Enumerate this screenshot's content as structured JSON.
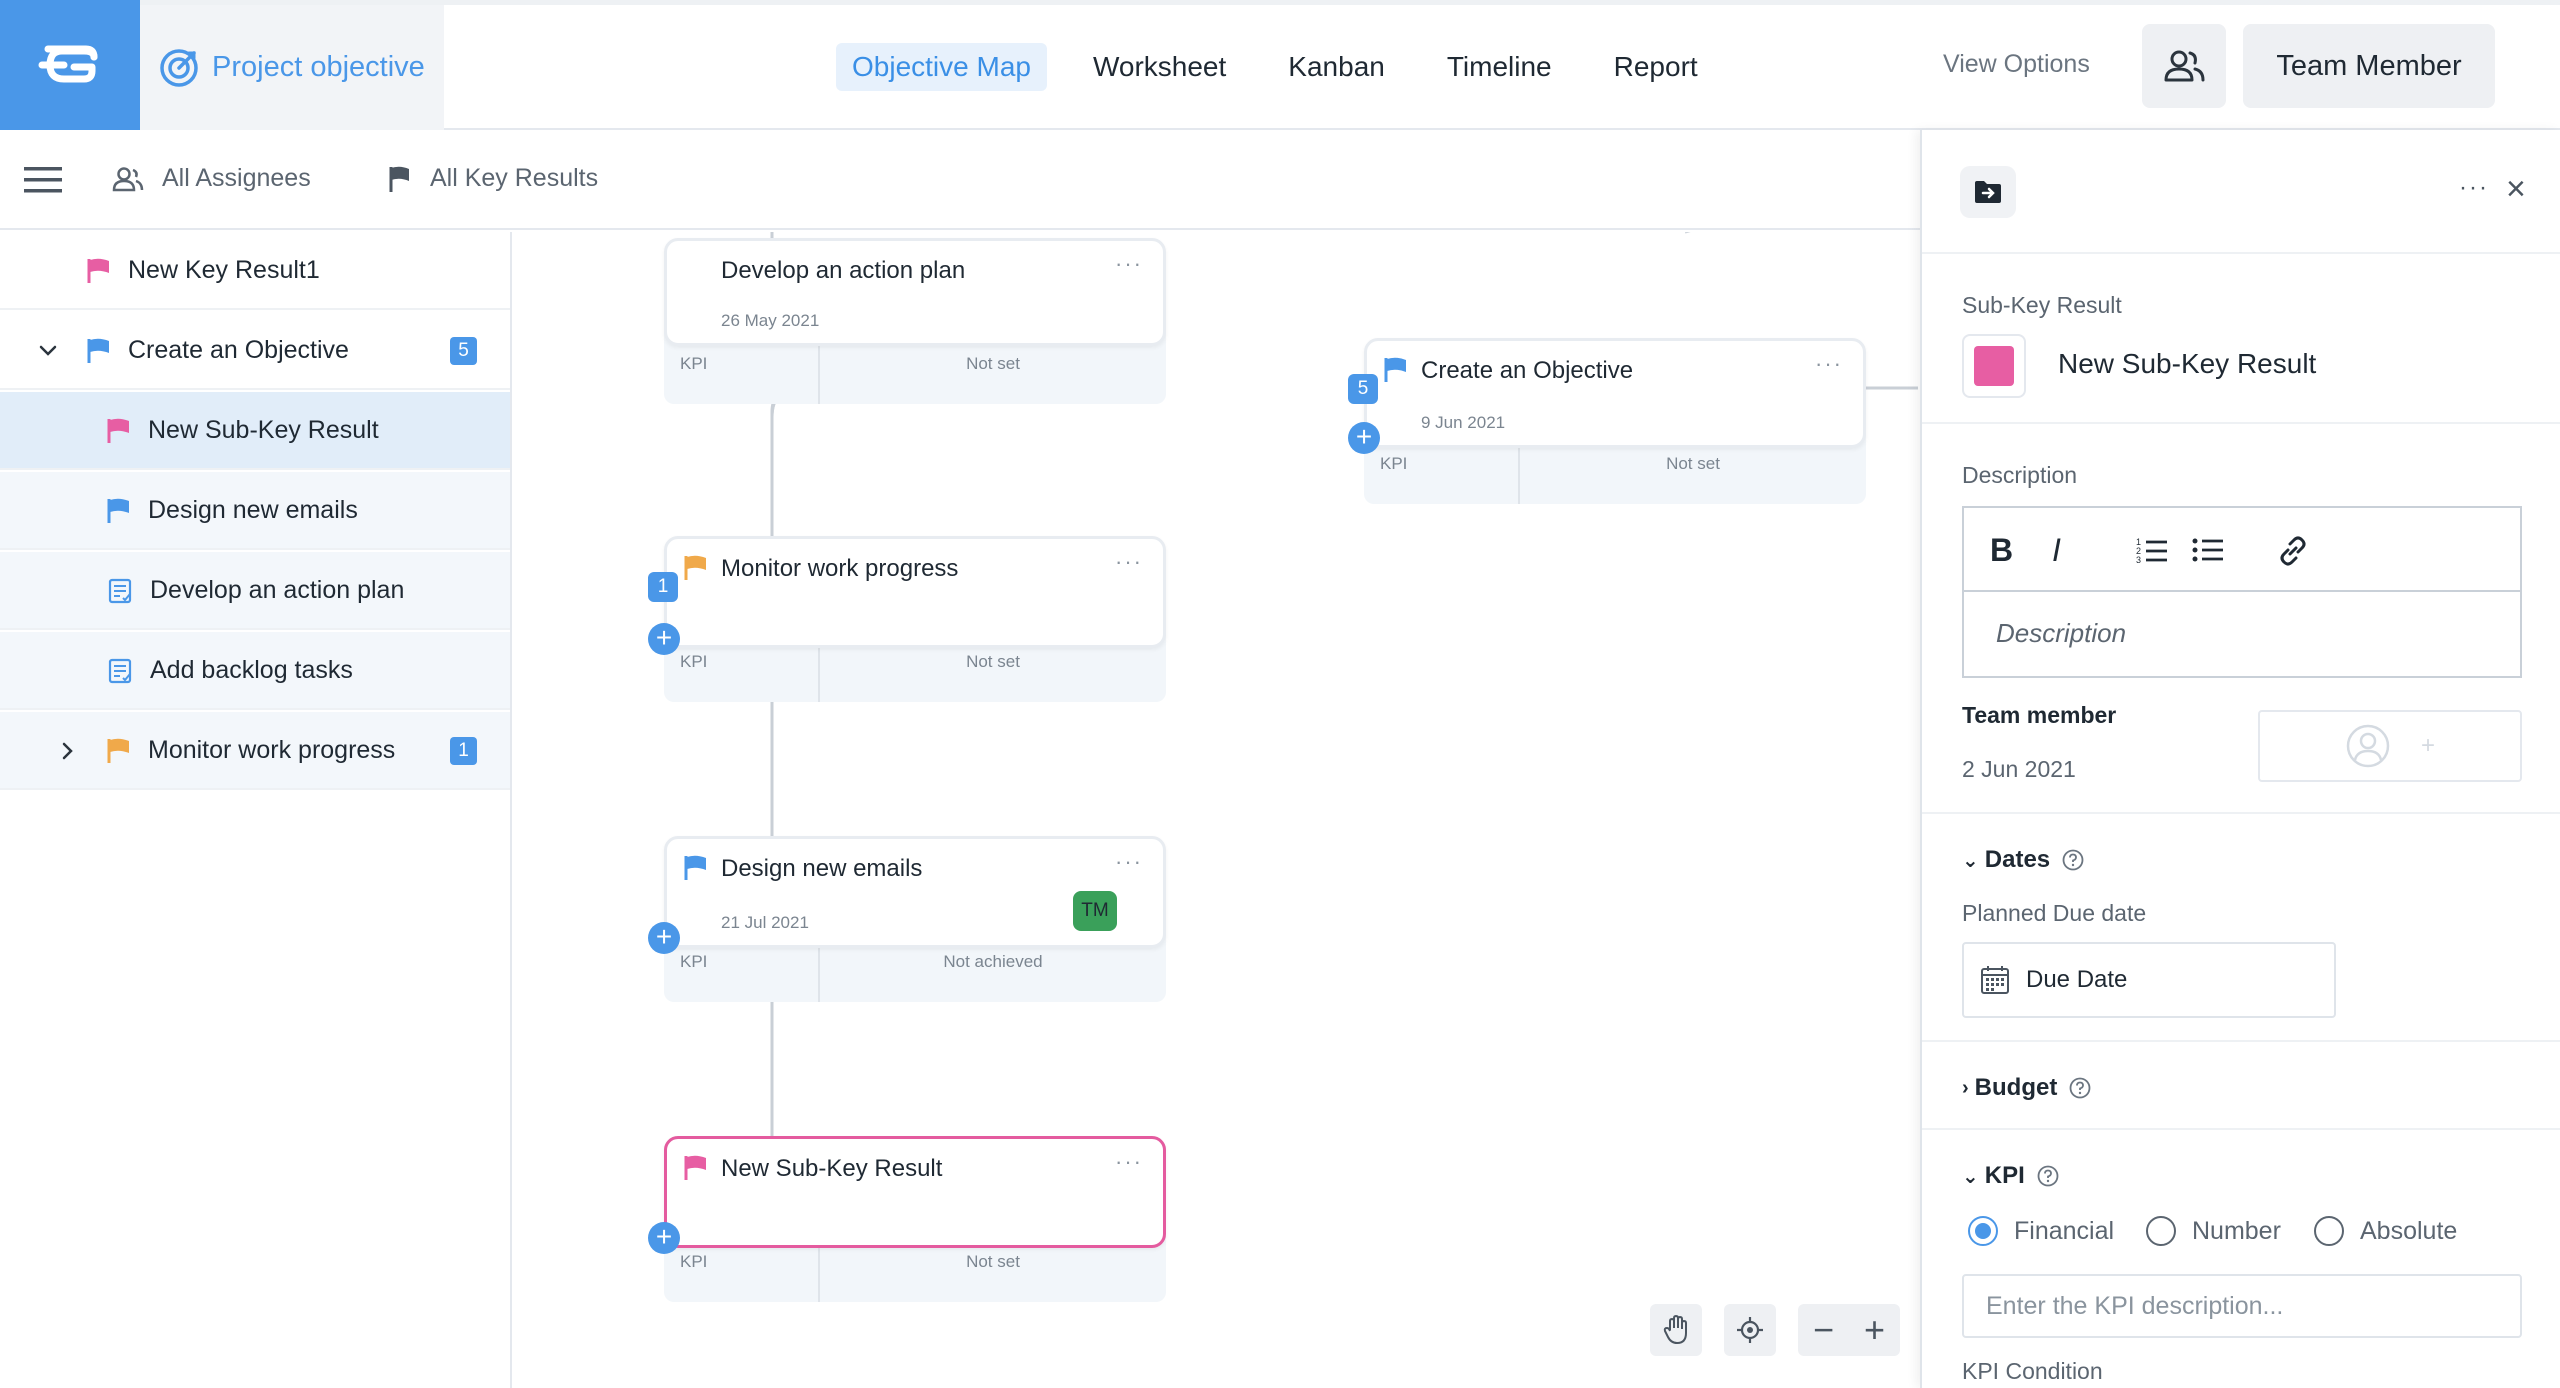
{
  "header": {
    "project_title": "Project objective",
    "tabs": [
      {
        "label": "Objective Map",
        "active": true
      },
      {
        "label": "Worksheet",
        "active": false
      },
      {
        "label": "Kanban",
        "active": false
      },
      {
        "label": "Timeline",
        "active": false
      },
      {
        "label": "Report",
        "active": false
      }
    ],
    "view_options": "View Options",
    "team_member_button": "Team Member"
  },
  "filters": {
    "assignees": "All Assignees",
    "key_results": "All Key Results"
  },
  "tree": {
    "items": [
      {
        "label": "New Key Result1",
        "flag_color": "#e75ea3"
      },
      {
        "label": "Create an Objective",
        "flag_color": "#4a97e8",
        "badge": "5"
      },
      {
        "label": "New Sub-Key Result",
        "flag_color": "#e75ea3"
      },
      {
        "label": "Design new emails",
        "flag_color": "#4a97e8"
      },
      {
        "label": "Develop an action plan"
      },
      {
        "label": "Add backlog tasks"
      },
      {
        "label": "Monitor work progress",
        "flag_color": "#f0a94a",
        "badge": "1"
      }
    ]
  },
  "canvas": {
    "nodes": [
      {
        "title": "Develop an action plan",
        "date": "26 May 2021",
        "kpi_label": "KPI",
        "status": "Not set"
      },
      {
        "title": "Monitor work progress",
        "date": "",
        "kpi_label": "KPI",
        "status": "Not set",
        "badge": "1"
      },
      {
        "title": "Design new emails",
        "date": "21 Jul 2021",
        "kpi_label": "KPI",
        "status": "Not achieved",
        "assignee_initials": "TM"
      },
      {
        "title": "New Sub-Key Result",
        "date": "",
        "kpi_label": "KPI",
        "status": "Not set"
      },
      {
        "title": "Create an Objective",
        "date": "9 Jun 2021",
        "kpi_label": "KPI",
        "status": "Not set",
        "badge": "5"
      }
    ],
    "more_glyph": "···",
    "zoom_out": "−",
    "zoom_in": "+"
  },
  "panel": {
    "type_label": "Sub-Key Result",
    "name": "New Sub-Key Result",
    "swatch_color": "#e75ea3",
    "description_label": "Description",
    "description_placeholder": "Description",
    "format_bold": "B",
    "format_italic": "I",
    "team_member_label": "Team member",
    "team_member_date": "2 Jun 2021",
    "team_member_add": "+",
    "dates_label": "Dates",
    "planned_due_label": "Planned Due date",
    "due_date_label": "Due Date",
    "budget_label": "Budget",
    "kpi_label": "KPI",
    "kpi_types": [
      {
        "label": "Financial",
        "checked": true
      },
      {
        "label": "Number",
        "checked": false
      },
      {
        "label": "Absolute",
        "checked": false
      }
    ],
    "kpi_placeholder": "Enter the KPI description...",
    "kpi_condition_label": "KPI Condition",
    "more_glyph": "···",
    "close_glyph": "×",
    "chevron_expanded": "⌄",
    "chevron_collapsed": "›"
  },
  "colors": {
    "accent": "#4a97e8",
    "pink": "#e75ea3",
    "orange": "#f0a94a",
    "avatar_green": "#3aa05a"
  }
}
